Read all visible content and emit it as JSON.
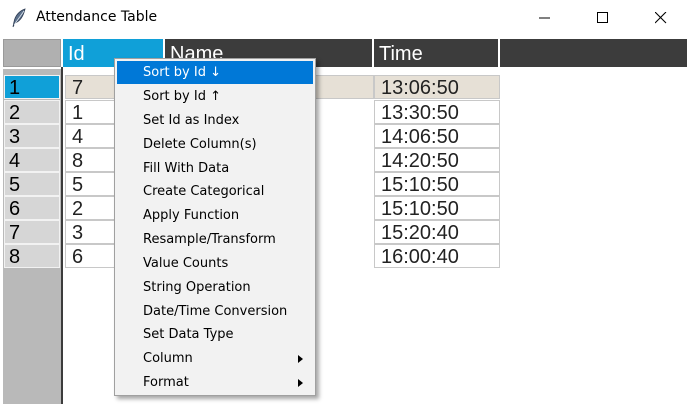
{
  "window": {
    "title": "Attendance Table"
  },
  "table": {
    "columns": [
      "Id",
      "Name",
      "Time"
    ],
    "selected_column": "Id",
    "row_index": [
      "1",
      "2",
      "3",
      "4",
      "5",
      "6",
      "7",
      "8"
    ],
    "selected_row_index": "1",
    "rows": [
      {
        "id": "7",
        "time": "13:06:50"
      },
      {
        "id": "1",
        "time": "13:30:50"
      },
      {
        "id": "4",
        "time": "14:06:50"
      },
      {
        "id": "8",
        "time": "14:20:50"
      },
      {
        "id": "5",
        "time": "15:10:50"
      },
      {
        "id": "2",
        "time": "15:10:50"
      },
      {
        "id": "3",
        "time": "15:20:40"
      },
      {
        "id": "6",
        "time": "16:00:40"
      }
    ]
  },
  "context_menu": {
    "items": [
      {
        "label": "Sort by Id ↓",
        "active": true
      },
      {
        "label": "Sort by Id ↑"
      },
      {
        "label": "Set Id as Index"
      },
      {
        "label": "Delete Column(s)"
      },
      {
        "label": "Fill With Data"
      },
      {
        "label": "Create Categorical"
      },
      {
        "label": "Apply Function"
      },
      {
        "label": "Resample/Transform"
      },
      {
        "label": "Value Counts"
      },
      {
        "label": "String Operation"
      },
      {
        "label": "Date/Time Conversion"
      },
      {
        "label": "Set Data Type"
      },
      {
        "label": "Column",
        "submenu": true
      },
      {
        "label": "Format",
        "submenu": true
      }
    ]
  },
  "colors": {
    "selected_header": "#10a0d8",
    "menu_highlight": "#0078d7",
    "header_bg": "#3c3c3c"
  }
}
